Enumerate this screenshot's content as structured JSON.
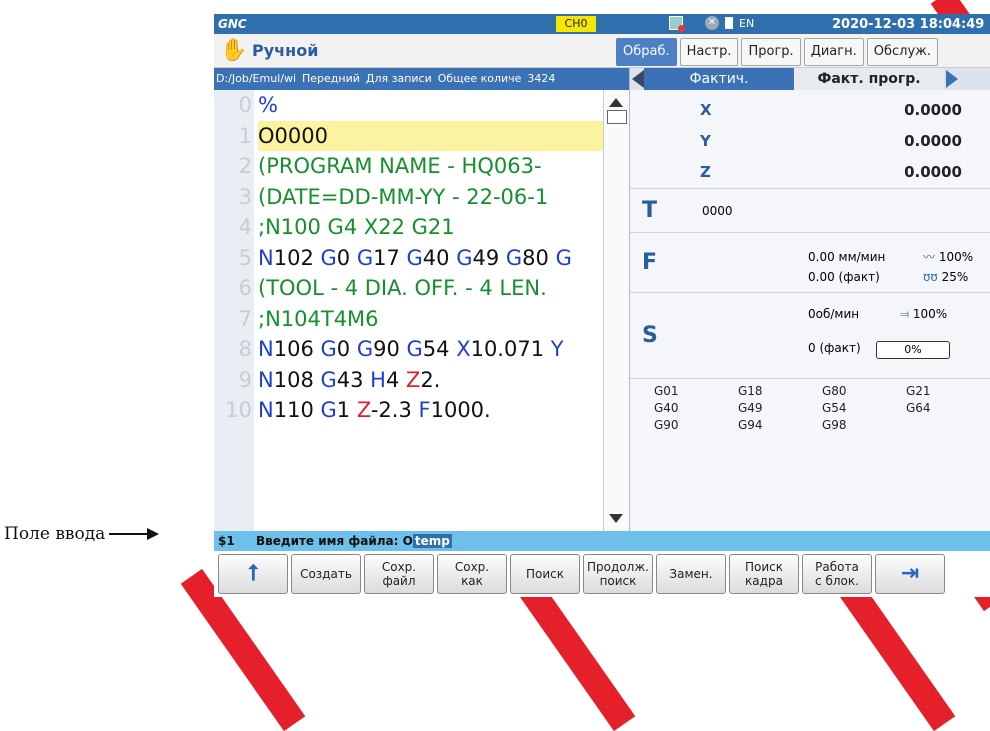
{
  "annotation": {
    "label": "Поле ввода"
  },
  "topbar": {
    "logo": "GNC",
    "channel": "CH0",
    "lang": "EN",
    "datetime": "2020-12-03 18:04:49"
  },
  "mode": {
    "label": "Ручной"
  },
  "tabs": [
    "Обраб.",
    "Настр.",
    "Прогр.",
    "Диагн.",
    "Обслуж."
  ],
  "pathbar": {
    "path": "D:/Job/Emul/wi",
    "f1": "Передний",
    "f2": "Для записи",
    "f3": "Общее количе",
    "count": "3424"
  },
  "code": {
    "line_numbers": [
      "0",
      "1",
      "2",
      "3",
      "4",
      "5",
      "6",
      "7",
      "8",
      "9",
      "10"
    ],
    "lines": [
      [
        {
          "t": "%",
          "c": "blue"
        }
      ],
      [
        {
          "t": "O0000",
          "c": "black"
        }
      ],
      [
        {
          "t": "(PROGRAM NAME - HQ063-",
          "c": "green"
        }
      ],
      [
        {
          "t": "(DATE=DD-MM-YY - 22-06-1",
          "c": "green"
        }
      ],
      [
        {
          "t": ";N100 G4 X22 G21",
          "c": "green"
        }
      ],
      [
        {
          "t": "N",
          "c": "blue"
        },
        {
          "t": "102 ",
          "c": "black"
        },
        {
          "t": "G",
          "c": "blue"
        },
        {
          "t": "0 ",
          "c": "black"
        },
        {
          "t": "G",
          "c": "blue"
        },
        {
          "t": "17 ",
          "c": "black"
        },
        {
          "t": "G",
          "c": "blue"
        },
        {
          "t": "40 ",
          "c": "black"
        },
        {
          "t": "G",
          "c": "blue"
        },
        {
          "t": "49 ",
          "c": "black"
        },
        {
          "t": "G",
          "c": "blue"
        },
        {
          "t": "80 ",
          "c": "black"
        },
        {
          "t": "G",
          "c": "blue"
        }
      ],
      [
        {
          "t": "(TOOL - 4 DIA. OFF. - 4 LEN.",
          "c": "green"
        }
      ],
      [
        {
          "t": ";N104T4M6",
          "c": "green"
        }
      ],
      [
        {
          "t": "N",
          "c": "blue"
        },
        {
          "t": "106 ",
          "c": "black"
        },
        {
          "t": "G",
          "c": "blue"
        },
        {
          "t": "0 ",
          "c": "black"
        },
        {
          "t": "G",
          "c": "blue"
        },
        {
          "t": "90 ",
          "c": "black"
        },
        {
          "t": "G",
          "c": "blue"
        },
        {
          "t": "54 ",
          "c": "black"
        },
        {
          "t": "X",
          "c": "blue"
        },
        {
          "t": "10.071 ",
          "c": "black"
        },
        {
          "t": "Y",
          "c": "blue"
        }
      ],
      [
        {
          "t": "N",
          "c": "blue"
        },
        {
          "t": "108 ",
          "c": "black"
        },
        {
          "t": "G",
          "c": "blue"
        },
        {
          "t": "43 ",
          "c": "black"
        },
        {
          "t": "H",
          "c": "blue"
        },
        {
          "t": "4 ",
          "c": "black"
        },
        {
          "t": "Z",
          "c": "red"
        },
        {
          "t": "2.",
          "c": "black"
        }
      ],
      [
        {
          "t": "N",
          "c": "blue"
        },
        {
          "t": "110 ",
          "c": "black"
        },
        {
          "t": "G",
          "c": "blue"
        },
        {
          "t": "1 ",
          "c": "black"
        },
        {
          "t": "Z",
          "c": "red"
        },
        {
          "t": "-2.3 ",
          "c": "black"
        },
        {
          "t": "F",
          "c": "blue"
        },
        {
          "t": "1000.",
          "c": "black"
        }
      ]
    ],
    "selected_index": 1
  },
  "right_tabs": {
    "active": "Фактич.",
    "other": "Факт. прогр."
  },
  "axes": [
    {
      "name": "X",
      "value": "0.0000"
    },
    {
      "name": "Y",
      "value": "0.0000"
    },
    {
      "name": "Z",
      "value": "0.0000"
    }
  ],
  "tool": {
    "label": "T",
    "value": "0000"
  },
  "feed": {
    "label": "F",
    "cmd": "0.00 мм/мин",
    "override": "100%",
    "actual": "0.00 (факт)",
    "rapid": "25%"
  },
  "spindle": {
    "label": "S",
    "cmd": "0об/мин",
    "override": "100%",
    "actual": "0 (факт)",
    "load": "0%"
  },
  "gcodes": [
    "G01",
    "G18",
    "G80",
    "G21",
    "G40",
    "G49",
    "G54",
    "G64",
    "G90",
    "G94",
    "G98"
  ],
  "cmdline": {
    "prompt": "$1",
    "label": "Введите имя файла: O",
    "value": "temp"
  },
  "softkeys": [
    "",
    "Создать",
    "Сохр.\nфайл",
    "Сохр.\nкак",
    "Поиск",
    "Продолж.\nпоиск",
    "Замен.",
    "Поиск\nкадра",
    "Работа\nс блок.",
    ""
  ]
}
